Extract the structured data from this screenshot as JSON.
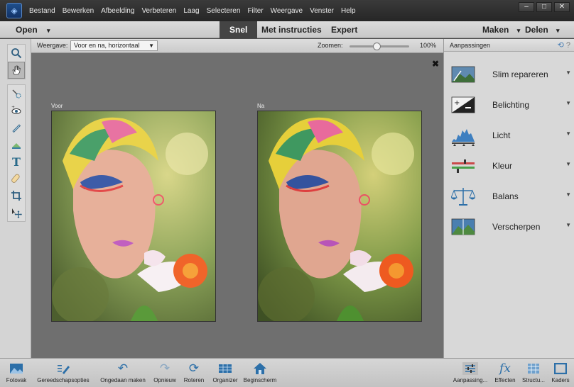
{
  "menu": {
    "items": [
      "Bestand",
      "Bewerken",
      "Afbeelding",
      "Verbeteren",
      "Laag",
      "Selecteren",
      "Filter",
      "Weergave",
      "Venster",
      "Help"
    ]
  },
  "window": {
    "minimize": "–",
    "maximize": "□",
    "close": "✕"
  },
  "modebar": {
    "open": "Open",
    "tabs": [
      "Snel",
      "Met instructies",
      "Expert"
    ],
    "active_tab": "Snel",
    "create": "Maken",
    "share": "Delen"
  },
  "options": {
    "view_label": "Weergave:",
    "view_value": "Voor en na, horizontaal",
    "zoom_label": "Zoomen:",
    "zoom_value": "100%",
    "zoom_level": 0.45
  },
  "canvas": {
    "before_label": "Voor",
    "after_label": "Na",
    "close": "✖"
  },
  "panel": {
    "title": "Aanpassingen",
    "items": [
      {
        "label": "Slim repareren",
        "icon": "smart-fix-icon"
      },
      {
        "label": "Belichting",
        "icon": "exposure-icon"
      },
      {
        "label": "Licht",
        "icon": "lighting-histogram-icon"
      },
      {
        "label": "Kleur",
        "icon": "color-slider-icon"
      },
      {
        "label": "Balans",
        "icon": "balance-scale-icon"
      },
      {
        "label": "Verscherpen",
        "icon": "sharpen-icon"
      }
    ]
  },
  "bottom": {
    "left": [
      {
        "label": "Fotovak",
        "icon": "photo-bin-icon"
      },
      {
        "label": "Gereedschapsopties",
        "icon": "tool-options-icon"
      },
      {
        "label": "Ongedaan maken",
        "icon": "undo-icon"
      },
      {
        "label": "Opnieuw",
        "icon": "redo-icon"
      },
      {
        "label": "Roteren",
        "icon": "rotate-icon"
      },
      {
        "label": "Organizer",
        "icon": "organizer-icon"
      },
      {
        "label": "Beginscherm",
        "icon": "home-icon"
      }
    ],
    "right": [
      {
        "label": "Aanpassing...",
        "icon": "adjustments-icon"
      },
      {
        "label": "Effecten",
        "icon": "fx-icon"
      },
      {
        "label": "Structu...",
        "icon": "textures-icon"
      },
      {
        "label": "Kaders",
        "icon": "frames-icon"
      }
    ]
  },
  "colors": {
    "accent": "#2c6fa8",
    "canvas_bg": "#6f6f6f",
    "menubar_bg": "#2e2e2e"
  }
}
